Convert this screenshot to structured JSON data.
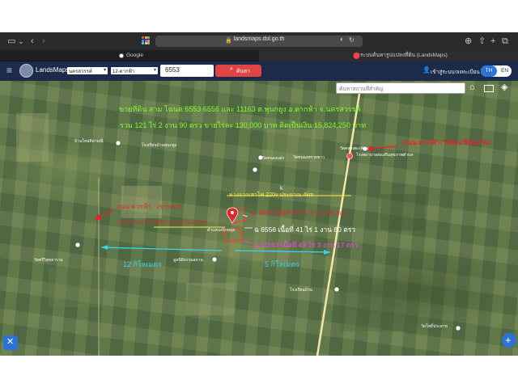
{
  "browser": {
    "url": "landsmaps.dol.go.th",
    "tabs": [
      {
        "label": "Google"
      },
      {
        "label": "ระบบค้นหารูปแปลงที่ดิน (LandsMaps)"
      }
    ]
  },
  "app": {
    "logo_text": "LandsMaps",
    "province_select": "นครสวรรค์",
    "district_select": "12-ตากฟ้า",
    "parcel_input": "6553",
    "search_button": "ค้นหา",
    "login_label": "เข้าสู่ระบบ/ลงทะเบียน",
    "lang_th": "TH",
    "lang_en": "EN",
    "place_search_placeholder": "ค้นหาสถานที่สำคัญ"
  },
  "annotations": {
    "headline1": "ขายที่ดิน สาม โฉนด 6553 6556 และ 11163 ต.พุนกยูง อ.ตากฟ้า จ.นครสวรรค์",
    "headline2": "รวม  121 ไร่ 2 งาน 90  ตรว ขายไร่ละ 130,000 บาท คิดเป็นเงิน 15,824,250 บาท",
    "road_right": "ถนน ตากฟ้า-วังทอง พิษณุโลก",
    "road_left": "ถนน ตากฟ้า - เขาทราย",
    "power_right": "ห่างจากเสาไฟ 220v ประมาณ 4km",
    "power_left": "ห่างจากเสาไฟ 220v ประมาณ3.5 km",
    "plot1": "ฉ. 6553 เนื้อที่ 30 ไร่ 1 งาน 93 ตรว",
    "plot2": "ฉ 6556 เนื้อที่ 41 ไร่ 1 งาน 80 ตรว",
    "plot3": "ฉ 11163 เนื้อที่ 49 ไร่ 3 งาน 17 ตรว",
    "dist_left": "12 กิโลเมตร",
    "dist_right": "5 กิโลเมตร",
    "k_label": "k"
  },
  "places": [
    {
      "name": "บ้านใหม่ศิลามณี"
    },
    {
      "name": "โรงเรียนบ้านพุนกยูง"
    },
    {
      "name": "วัดหนองแฝก"
    },
    {
      "name": "วัดหนองทรายขาว"
    },
    {
      "name": "วัดคลองตะเคียน"
    },
    {
      "name": "โรงพยาบาลส่งเสริมสุขภาพตำบล"
    },
    {
      "name": "วัดศรีวิสุทธาราม"
    },
    {
      "name": "มูลนิธิธรรมสถาน"
    },
    {
      "name": "ดำแหน่งปักหมุด"
    },
    {
      "name": "วัดโพธิ์ประสาท"
    },
    {
      "name": "โรงเรียนบ้าน"
    }
  ],
  "colors": {
    "green_text": "#7CFF2E",
    "red_text": "#E0262B",
    "yellow_text": "#FFE84A",
    "pink_text": "#FF44E8",
    "cyan_line": "#33D6F0",
    "app_bar": "#1C2B4A",
    "search_red": "#E04545"
  }
}
